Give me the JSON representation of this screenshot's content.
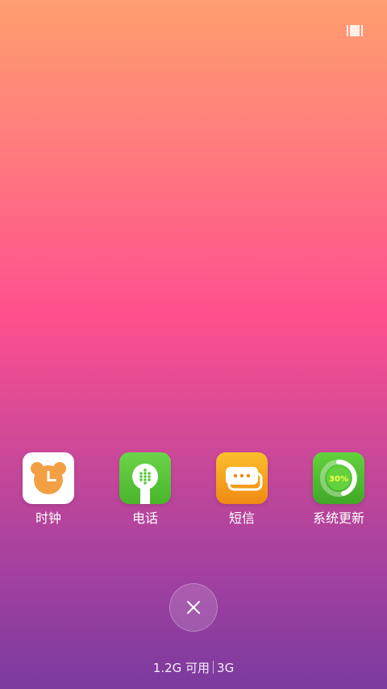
{
  "apps": [
    {
      "label": "时钟",
      "icon": "clock-icon",
      "color": "#F3A045"
    },
    {
      "label": "电话",
      "icon": "phone-icon",
      "color": "#5CC83A"
    },
    {
      "label": "短信",
      "icon": "message-icon",
      "color": "#F3A21B"
    },
    {
      "label": "系统更新",
      "icon": "system-update-icon",
      "color": "#4CB830",
      "progress_text": "30%"
    }
  ],
  "close_icon": "close-icon",
  "memory": {
    "available": "1.2G 可用",
    "total": "3G"
  }
}
